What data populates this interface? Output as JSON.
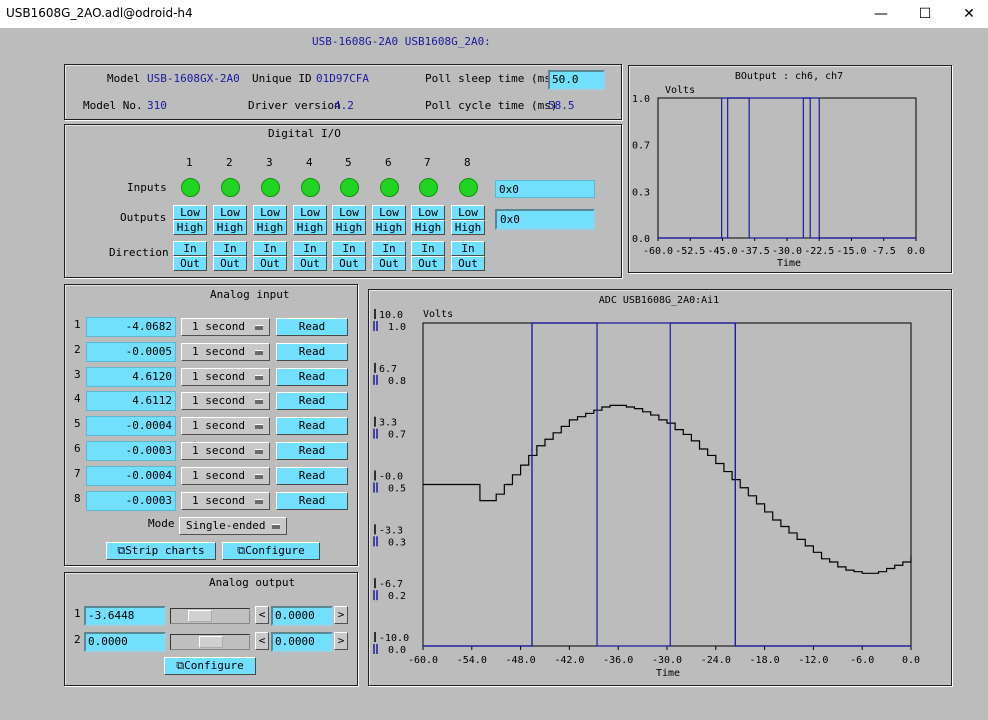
{
  "window": {
    "title": "USB1608G_2AO.adl@odroid-h4"
  },
  "header": {
    "text": "USB-1608G-2A0  USB1608G_2A0:"
  },
  "info": {
    "model_label": "Model",
    "model_value": "USB-1608GX-2A0",
    "unique_id_label": "Unique ID",
    "unique_id_value": "01D97CFA",
    "poll_sleep_label": "Poll sleep time (ms)",
    "poll_sleep_value": "50.0",
    "model_no_label": "Model No.",
    "model_no_value": "310",
    "driver_version_label": "Driver version",
    "driver_version_value": "4.2",
    "poll_cycle_label": "Poll cycle time (ms)",
    "poll_cycle_value": "58.5"
  },
  "digital_io": {
    "title": "Digital I/O",
    "channels": [
      "1",
      "2",
      "3",
      "4",
      "5",
      "6",
      "7",
      "8"
    ],
    "inputs_label": "Inputs",
    "inputs_value": "0x0",
    "outputs_label": "Outputs",
    "outputs_value": "0x0",
    "low_label": "Low",
    "high_label": "High",
    "direction_label": "Direction",
    "in_label": "In",
    "out_label": "Out",
    "led_color": "#22d422"
  },
  "analog_input": {
    "title": "Analog input",
    "rows": [
      {
        "ch": "1",
        "value": "-4.0682",
        "rate": "1 second",
        "read": "Read"
      },
      {
        "ch": "2",
        "value": "-0.0005",
        "rate": "1 second",
        "read": "Read"
      },
      {
        "ch": "3",
        "value": "4.6120",
        "rate": "1 second",
        "read": "Read"
      },
      {
        "ch": "4",
        "value": "4.6112",
        "rate": "1 second",
        "read": "Read"
      },
      {
        "ch": "5",
        "value": "-0.0004",
        "rate": "1 second",
        "read": "Read"
      },
      {
        "ch": "6",
        "value": "-0.0003",
        "rate": "1 second",
        "read": "Read"
      },
      {
        "ch": "7",
        "value": "-0.0004",
        "rate": "1 second",
        "read": "Read"
      },
      {
        "ch": "8",
        "value": "-0.0003",
        "rate": "1 second",
        "read": "Read"
      }
    ],
    "mode_label": "Mode",
    "mode_value": "Single-ended",
    "strip_charts": "Strip charts",
    "configure": "Configure"
  },
  "analog_output": {
    "title": "Analog output",
    "rows": [
      {
        "ch": "1",
        "value": "-3.6448",
        "step": "0.0000",
        "slider_fraction": 0.3
      },
      {
        "ch": "2",
        "value": "0.0000",
        "step": "0.0000",
        "slider_fraction": 0.5
      }
    ],
    "left_arrow": "<",
    "right_arrow": ">",
    "configure": "Configure"
  },
  "chart_data": [
    {
      "type": "line",
      "title": "BOutput : ch6, ch7",
      "ylabel": "Volts",
      "xlabel": "Time",
      "xlim": [
        -60.0,
        0.0
      ],
      "ylim": [
        0.0,
        1.0
      ],
      "xticks": [
        "-60.0",
        "-52.5",
        "-45.0",
        "-37.5",
        "-30.0",
        "-22.5",
        "-15.0",
        "-7.5",
        "0.0"
      ],
      "yticks": [
        "0.0",
        "0.3",
        "0.7",
        "1.0"
      ],
      "series": [
        {
          "color": "#1c1c9c",
          "x": [
            -60,
            -45.2,
            -45.2,
            -38.8,
            -38.8,
            -26.2,
            -26.2,
            -24.4,
            -24.4,
            -22.5,
            -22.5,
            0
          ],
          "y": [
            0,
            0,
            1,
            1,
            0,
            0,
            1,
            1,
            1,
            1,
            0,
            0
          ]
        },
        {
          "color": "#1c1c9c",
          "x": [
            -60,
            -43.8,
            -43.8,
            -24.6,
            -24.6,
            0
          ],
          "y": [
            0,
            0,
            1,
            1,
            0,
            0
          ]
        }
      ]
    },
    {
      "type": "line",
      "title": "ADC USB1608G_2A0:Ai1",
      "ylabel": "Volts",
      "xlabel": "Time",
      "xlim": [
        -60.0,
        0.0
      ],
      "xticks": [
        "-60.0",
        "-54.0",
        "-48.0",
        "-42.0",
        "-36.0",
        "-30.0",
        "-24.0",
        "-18.0",
        "-12.0",
        "-6.0",
        "0.0"
      ],
      "yticks_left": [
        "10.0",
        "6.7",
        "3.3",
        "-0.0",
        "-3.3",
        "-6.7",
        "-10.0"
      ],
      "yticks_right": [
        "1.0",
        "0.8",
        "0.7",
        "0.5",
        "0.3",
        "0.2",
        "0.0"
      ],
      "series": [
        {
          "color": "#000000",
          "x": [
            -60,
            -54,
            -53,
            -52,
            -51,
            -50,
            -49,
            -48,
            -47,
            -46,
            -45,
            -44,
            -43,
            -42,
            -41,
            -40,
            -39,
            -38,
            -37,
            -36,
            -35,
            -34,
            -33,
            -32,
            -31,
            -30,
            -29,
            -28,
            -27,
            -26,
            -25,
            -24,
            -23,
            -22,
            -21,
            -20,
            -19,
            -18,
            -17,
            -16,
            -15,
            -14,
            -13,
            -12,
            -11,
            -10,
            -9,
            -8,
            -7,
            -6,
            -5,
            -4,
            -3,
            -2,
            -1,
            0
          ],
          "y": [
            0.5,
            0.5,
            0.45,
            0.45,
            0.47,
            0.5,
            0.53,
            0.56,
            0.59,
            0.62,
            0.64,
            0.66,
            0.68,
            0.7,
            0.71,
            0.72,
            0.73,
            0.74,
            0.745,
            0.745,
            0.74,
            0.735,
            0.725,
            0.715,
            0.7,
            0.69,
            0.67,
            0.655,
            0.635,
            0.61,
            0.59,
            0.565,
            0.54,
            0.515,
            0.49,
            0.465,
            0.44,
            0.415,
            0.39,
            0.37,
            0.35,
            0.33,
            0.31,
            0.29,
            0.27,
            0.26,
            0.245,
            0.235,
            0.23,
            0.225,
            0.225,
            0.23,
            0.24,
            0.25,
            0.26,
            0.28
          ]
        },
        {
          "color": "#1c1c9c",
          "x": [
            -60,
            -46.6,
            -46.6,
            -38.6,
            -38.6,
            -29.6,
            -29.6,
            -21.6,
            -21.6,
            0
          ],
          "y": [
            0,
            0,
            1,
            1,
            0,
            0,
            1,
            1,
            0,
            0
          ]
        },
        {
          "color": "#1c1c9c",
          "x": [
            -60,
            -46.6,
            -46.6,
            -21.6,
            -21.6,
            0
          ],
          "y": [
            0,
            0,
            1,
            1,
            0,
            0
          ]
        }
      ]
    }
  ]
}
